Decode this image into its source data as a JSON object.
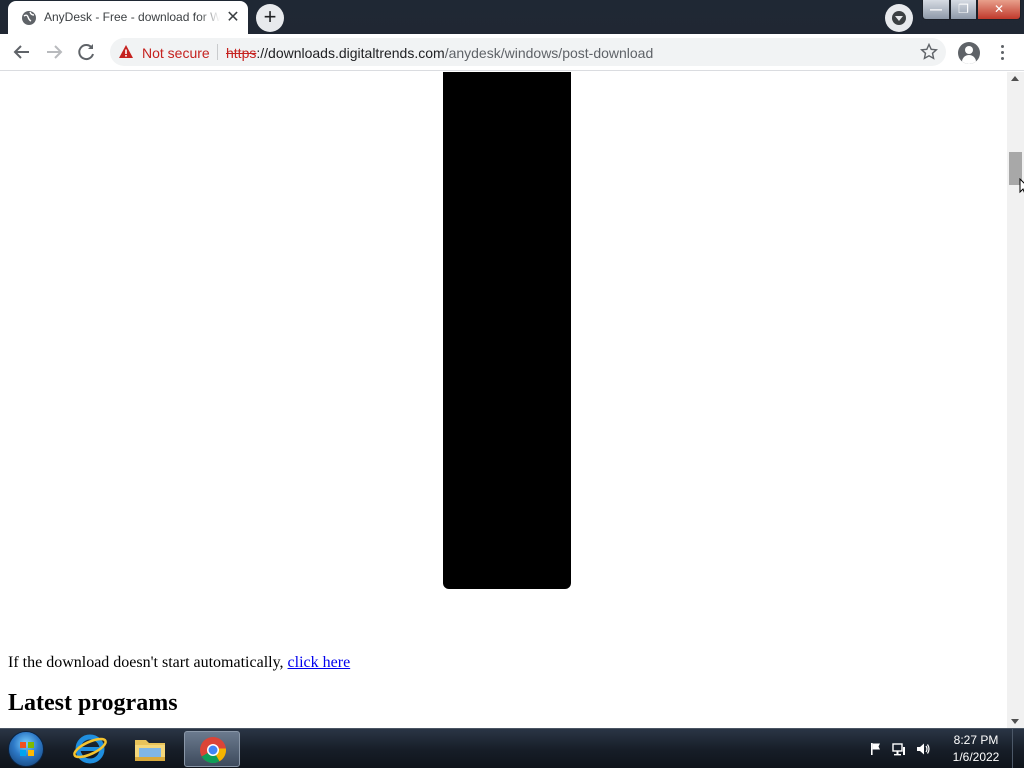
{
  "browser": {
    "tab": {
      "title": "AnyDesk - Free - download for Windows",
      "close_glyph": "✕",
      "favicon": "globe-icon"
    },
    "new_tab_glyph": "+",
    "window_controls": {
      "minimize": "—",
      "restore": "❐",
      "close": "✕"
    },
    "omnibox": {
      "security_label": "Not secure",
      "url_scheme": "https",
      "url_host": "://downloads.digitaltrends.com",
      "url_path": "/anydesk/windows/post-download"
    }
  },
  "page": {
    "fallback_text": "If the download doesn't start automatically, ",
    "fallback_link": "click here",
    "latest_heading": "Latest programs"
  },
  "taskbar": {
    "apps": [
      "Internet Explorer",
      "Windows Explorer",
      "Google Chrome"
    ],
    "clock_time": "8:27 PM",
    "clock_date": "1/6/2022"
  }
}
